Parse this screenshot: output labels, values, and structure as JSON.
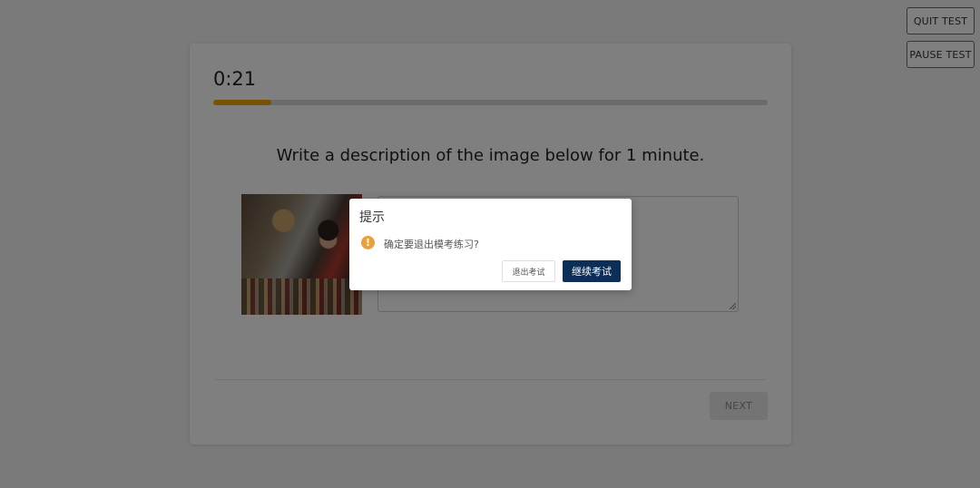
{
  "top_buttons": {
    "quit_label": "QUIT TEST",
    "pause_label": "PAUSE TEST"
  },
  "test": {
    "timer": "0:21",
    "progress_fraction": 0.105,
    "instruction": "Write a description of the image below for 1 minute.",
    "next_label": "NEXT"
  },
  "dialog": {
    "title": "提示",
    "icon": "warning-icon",
    "icon_glyph": "!",
    "message": "确定要退出模考练习?",
    "exit_label": "退出考试",
    "continue_label": "继续考试"
  },
  "colors": {
    "progress": "#f5a300",
    "primary_button": "#0d2f57",
    "warning": "#e6a23c"
  }
}
